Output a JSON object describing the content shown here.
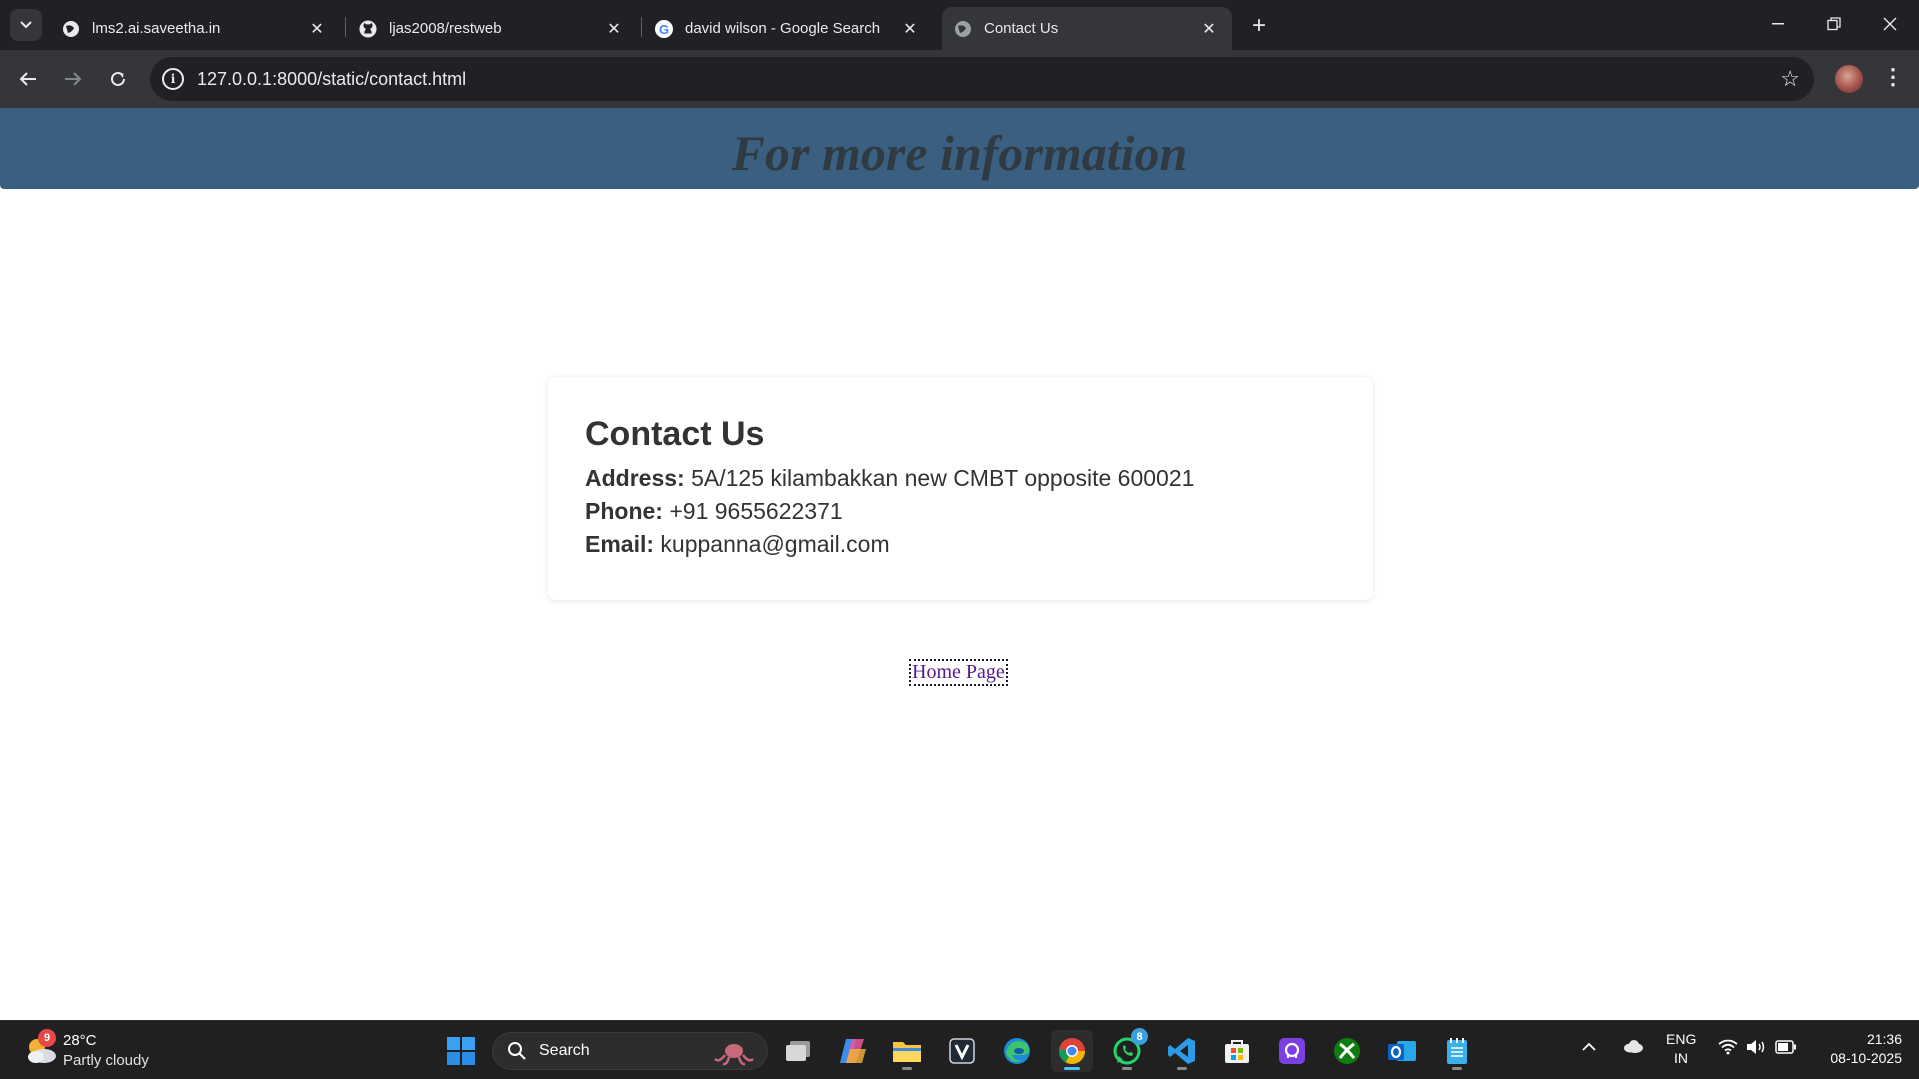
{
  "browser": {
    "tabs": [
      {
        "title": "lms2.ai.saveetha.in",
        "favicon": "globe-icon",
        "active": false
      },
      {
        "title": "ljas2008/restweb",
        "favicon": "github-icon",
        "active": false
      },
      {
        "title": "david wilson - Google Search",
        "favicon": "google-icon",
        "active": false
      },
      {
        "title": "Contact Us",
        "favicon": "globe-icon",
        "active": true
      }
    ],
    "url": "127.0.0.1:8000/static/contact.html"
  },
  "page": {
    "banner_title": "For more information",
    "card": {
      "heading": "Contact Us",
      "address_label": "Address:",
      "address_value": "5A/125 kilambakkan new CMBT opposite 600021",
      "phone_label": "Phone:",
      "phone_value": "+91 9655622371",
      "email_label": "Email:",
      "email_value": "kuppanna@gmail.com"
    },
    "home_link": "Home Page"
  },
  "taskbar": {
    "weather": {
      "temp": "28°C",
      "desc": "Partly cloudy",
      "badge": "9"
    },
    "search_label": "Search",
    "whatsapp_badge": "8",
    "lang_line1": "ENG",
    "lang_line2": "IN",
    "time": "21:36",
    "date": "08-10-2025"
  },
  "colors": {
    "banner": "#3b5f80",
    "banner_text": "#2f3a42",
    "link_visited": "#551a8b",
    "chrome_dark": "#202124",
    "chrome_toolbar": "#35363a"
  }
}
